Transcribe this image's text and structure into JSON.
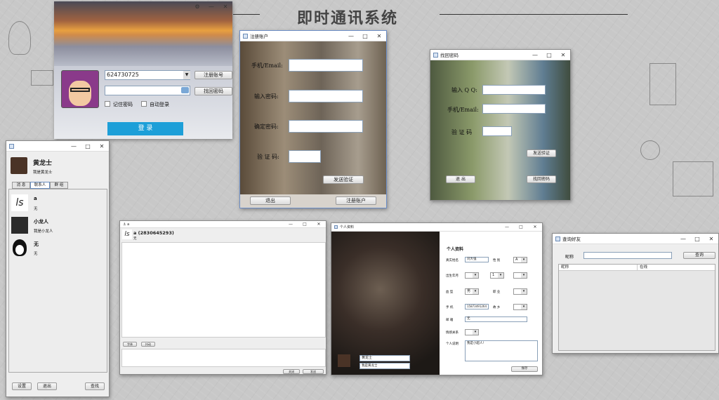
{
  "page_title": "即时通讯系统",
  "login": {
    "account": "624730725",
    "register_btn": "注册账号",
    "find_pwd_btn": "找回密码",
    "remember_label": "记住密码",
    "auto_login_label": "自动登录",
    "login_btn": "登 录"
  },
  "register": {
    "title": "注册账户",
    "email_label": "手机/Email:",
    "pwd_label": "输入密码:",
    "confirm_label": "确定密码:",
    "code_label": "验 证 码:",
    "send_code_btn": "发送验证",
    "exit_btn": "退出",
    "submit_btn": "注册账户"
  },
  "recover": {
    "title": "找回密码",
    "qq_label": "输入 Q Q:",
    "email_label": "手机/Email:",
    "code_label": "验 证 码",
    "send_code_btn": "发送验证",
    "exit_btn": "退 出",
    "submit_btn": "找回密码"
  },
  "contacts": {
    "user_name": "黄龙士",
    "user_sig": "我是黄龙士",
    "tabs": [
      "消 息",
      "联系人",
      "群 组"
    ],
    "items": [
      {
        "name": "a",
        "sig": "无"
      },
      {
        "name": "小龙人",
        "sig": "我是小龙人"
      },
      {
        "name": "无",
        "sig": "无"
      }
    ],
    "settings_btn": "设置",
    "exit_btn": "退出",
    "find_btn": "查找"
  },
  "chat": {
    "contact": "a (2830645293)",
    "sub": "无",
    "tool1": "字体",
    "tool2": "抖动",
    "close_btn": "关闭",
    "send_btn": "发送"
  },
  "profile": {
    "title": "个人资料",
    "header": "个人资料",
    "name_label": "真实姓名",
    "name_value": "刘大强",
    "gender_label": "性 别",
    "gender_value": "A",
    "birth_label": "出生年月",
    "month_value": "1",
    "blood_label": "血 型",
    "blood_value": "男",
    "job_label": "职 业",
    "phone_label": "手 机",
    "phone_value": "15873491264",
    "home_label": "故 乡",
    "email_label": "邮 箱",
    "email_value": "无",
    "status_label": "情感关系",
    "intro_label": "个人说明",
    "intro_value": "我是小超人!",
    "save_btn": "保存",
    "nick_value": "黄龙士",
    "sig_value": "我是黄龙士"
  },
  "search": {
    "title": "查询好友",
    "nick_label": "昵称",
    "query_btn": "查询",
    "col_nick": "昵称",
    "col_online": "在线"
  }
}
